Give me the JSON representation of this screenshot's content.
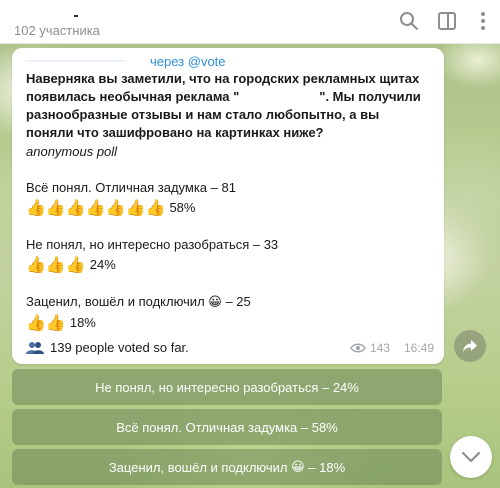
{
  "header": {
    "subtitle": "102 участника",
    "icons": [
      "search-icon",
      "sidebar-toggle-icon",
      "more-icon"
    ]
  },
  "message": {
    "forwarded_via": "через @vote",
    "question_part1": "Наверняка вы заметили, что на городских рекламных щитах появилась необычная реклама \"",
    "question_part2": "\". Мы получили разнообразные отзывы и нам стало любопытно, а вы поняли что зашифровано на картинках ниже?",
    "poll_type": "anonymous poll",
    "options": [
      {
        "label": "Всё понял. Отличная задумка – 81",
        "thumbs": "👍👍👍👍👍👍👍",
        "percent": "58%",
        "share": 0.58
      },
      {
        "label": "Не понял, но интересно разобраться – 33",
        "thumbs": "👍👍👍",
        "percent": "24%",
        "share": 0.24
      },
      {
        "label_text": "Заценил, вошёл и подключил",
        "label_emoji": "😀",
        "label_count": "– 25",
        "thumbs": "👍👍",
        "percent": "18%",
        "share": 0.18
      }
    ],
    "voters_text": "139 people voted so far.",
    "views": "143",
    "time": "16:49"
  },
  "keyboard": [
    {
      "label": "Не понял, но интересно разобраться – 24%"
    },
    {
      "label": "Всё понял. Отличная задумка – 58%"
    },
    {
      "label_text": "Заценил, вошёл и подключил",
      "label_emoji": "😀",
      "label_suffix": "– 18%"
    }
  ],
  "colors": {
    "link": "#2f8fd8",
    "meta_gray": "#a3a8ad",
    "button_bg": "rgba(110,135,90,0.55)"
  }
}
